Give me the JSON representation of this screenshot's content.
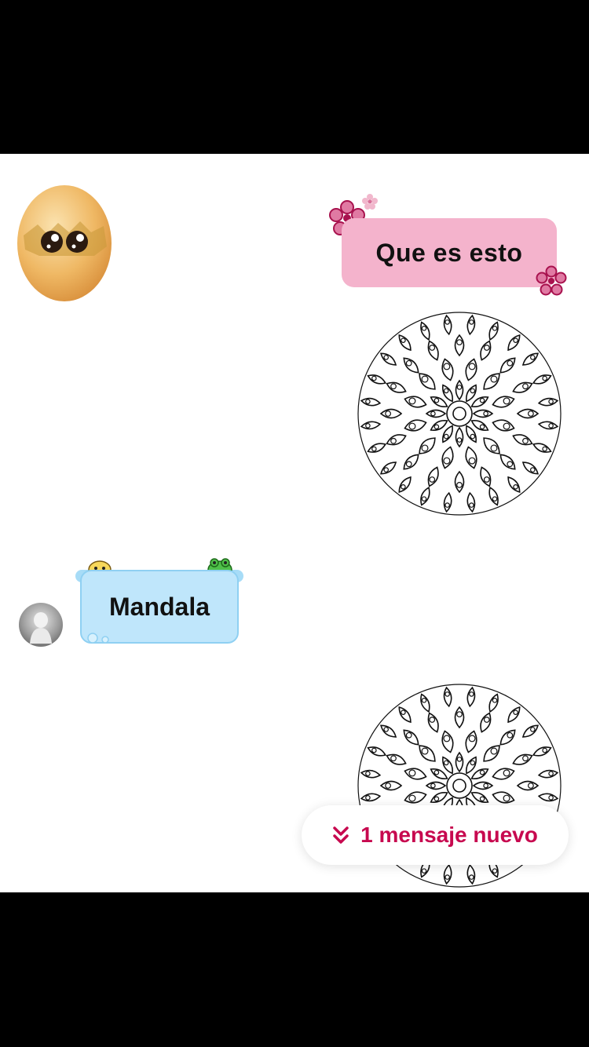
{
  "messages": {
    "outgoing_text": "Que es esto",
    "incoming_text": "Mandala"
  },
  "stickers": {
    "egg": "cracked-egg-eyes-sticker",
    "mandala": "mandala-image"
  },
  "new_message_pill": {
    "label": "1 mensaje nuevo",
    "icon": "double-chevron-down-icon"
  },
  "colors": {
    "outgoing_bubble": "#f4b3cc",
    "incoming_bubble": "#bfe6fb",
    "accent": "#c7094f"
  }
}
